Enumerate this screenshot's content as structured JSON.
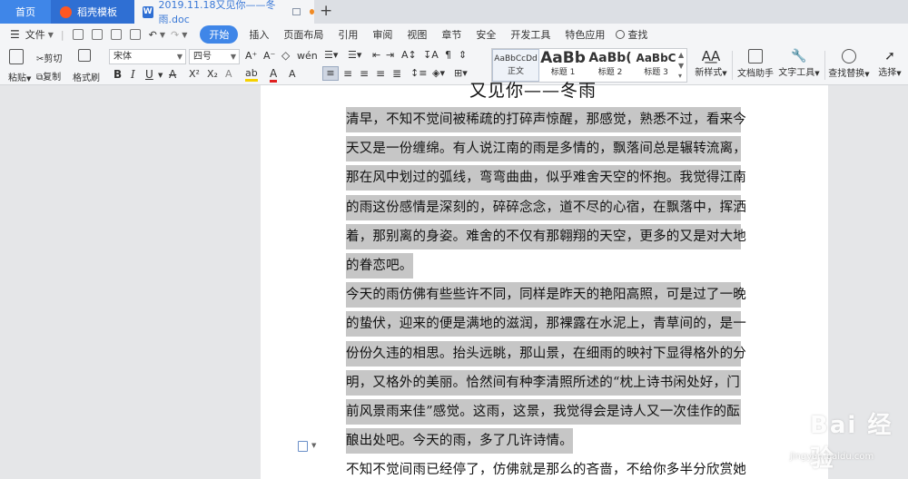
{
  "tabs": {
    "home": "首页",
    "daoke": "稻壳模板",
    "document": "2019.11.18又见你——冬雨.doc"
  },
  "menu": {
    "file": "文件",
    "items": [
      "开始",
      "插入",
      "页面布局",
      "引用",
      "审阅",
      "视图",
      "章节",
      "安全",
      "开发工具",
      "特色应用"
    ],
    "search": "查找"
  },
  "ribbon": {
    "paste": "粘贴",
    "cut": "剪切",
    "copy": "复制",
    "format_painter": "格式刷",
    "font_name": "宋体",
    "font_size": "四号",
    "styles": [
      {
        "sample": "AaBbCcDd",
        "label": "正文"
      },
      {
        "sample": "AaBb",
        "label": "标题 1"
      },
      {
        "sample": "AaBb(",
        "label": "标题 2"
      },
      {
        "sample": "AaBbC",
        "label": "标题 3"
      }
    ],
    "new_style": "新样式",
    "doc_helper": "文档助手",
    "text_tools": "文字工具",
    "find_replace": "查找替换",
    "select": "选择"
  },
  "document": {
    "title": "又见你——冬雨",
    "lines": [
      {
        "text": "清早，不知不觉间被稀疏的打碎声惊醒，那感觉，熟悉不过，看来今",
        "hl": true
      },
      {
        "text": "天又是一份缠绵。有人说江南的雨是多情的，飘落间总是辗转流离，",
        "hl": true
      },
      {
        "text": "那在风中划过的弧线，弯弯曲曲，似乎难舍天空的怀抱。我觉得江南",
        "hl": true
      },
      {
        "text": "的雨这份感情是深刻的，碎碎念念，道不尽的心宿，在飘落中，挥洒",
        "hl": true
      },
      {
        "text": "着，那别离的身姿。难舍的不仅有那翱翔的天空，更多的又是对大地",
        "hl": true
      },
      {
        "text": "的眷恋吧。",
        "hl": true
      },
      {
        "text": "今天的雨仿佛有些些许不同，同样是昨天的艳阳高照，可是过了一晚",
        "hl": true
      },
      {
        "text": "的蛰伏，迎来的便是满地的滋润，那裸露在水泥上，青草间的，是一",
        "hl": true
      },
      {
        "text": "份份久违的相思。抬头远眺，那山景，在细雨的映衬下显得格外的分",
        "hl": true
      },
      {
        "text": "明，又格外的美丽。恰然间有种李清照所述的“枕上诗书闲处好，门",
        "hl": true
      },
      {
        "text": "前风景雨来佳”感觉。这雨，这景，我觉得会是诗人又一次佳作的酝",
        "hl": true
      },
      {
        "text": "酿出处吧。今天的雨，多了几许诗情。",
        "hl": true
      },
      {
        "text": "不知不觉间雨已经停了，仿佛就是那么的吝啬，不给你多半分欣赏她",
        "hl": false
      }
    ]
  },
  "watermark": {
    "text": "Bai 经验",
    "url": "jingyan.baidu.com"
  }
}
